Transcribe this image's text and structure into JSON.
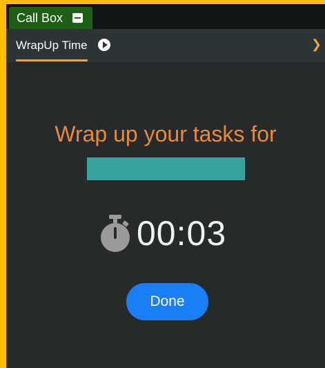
{
  "window": {
    "title": "Call Box",
    "minimize_icon": "minimize-icon"
  },
  "tabs": [
    {
      "label": "WrapUp Time",
      "active": true,
      "icon": "play-circle-icon"
    }
  ],
  "nav": {
    "next_icon": "chevron-right-icon"
  },
  "main": {
    "heading": "Wrap up your tasks for",
    "redacted_name_color": "#37a29e",
    "timer": "00:03",
    "timer_icon": "stopwatch-icon",
    "done_label": "Done"
  },
  "colors": {
    "accent": "#f5a03c",
    "heading": "#e88a3c",
    "button": "#1a7ff6",
    "tab_green": "#1c5f15",
    "frame_border": "#ffbf00",
    "background": "#262a2b"
  }
}
